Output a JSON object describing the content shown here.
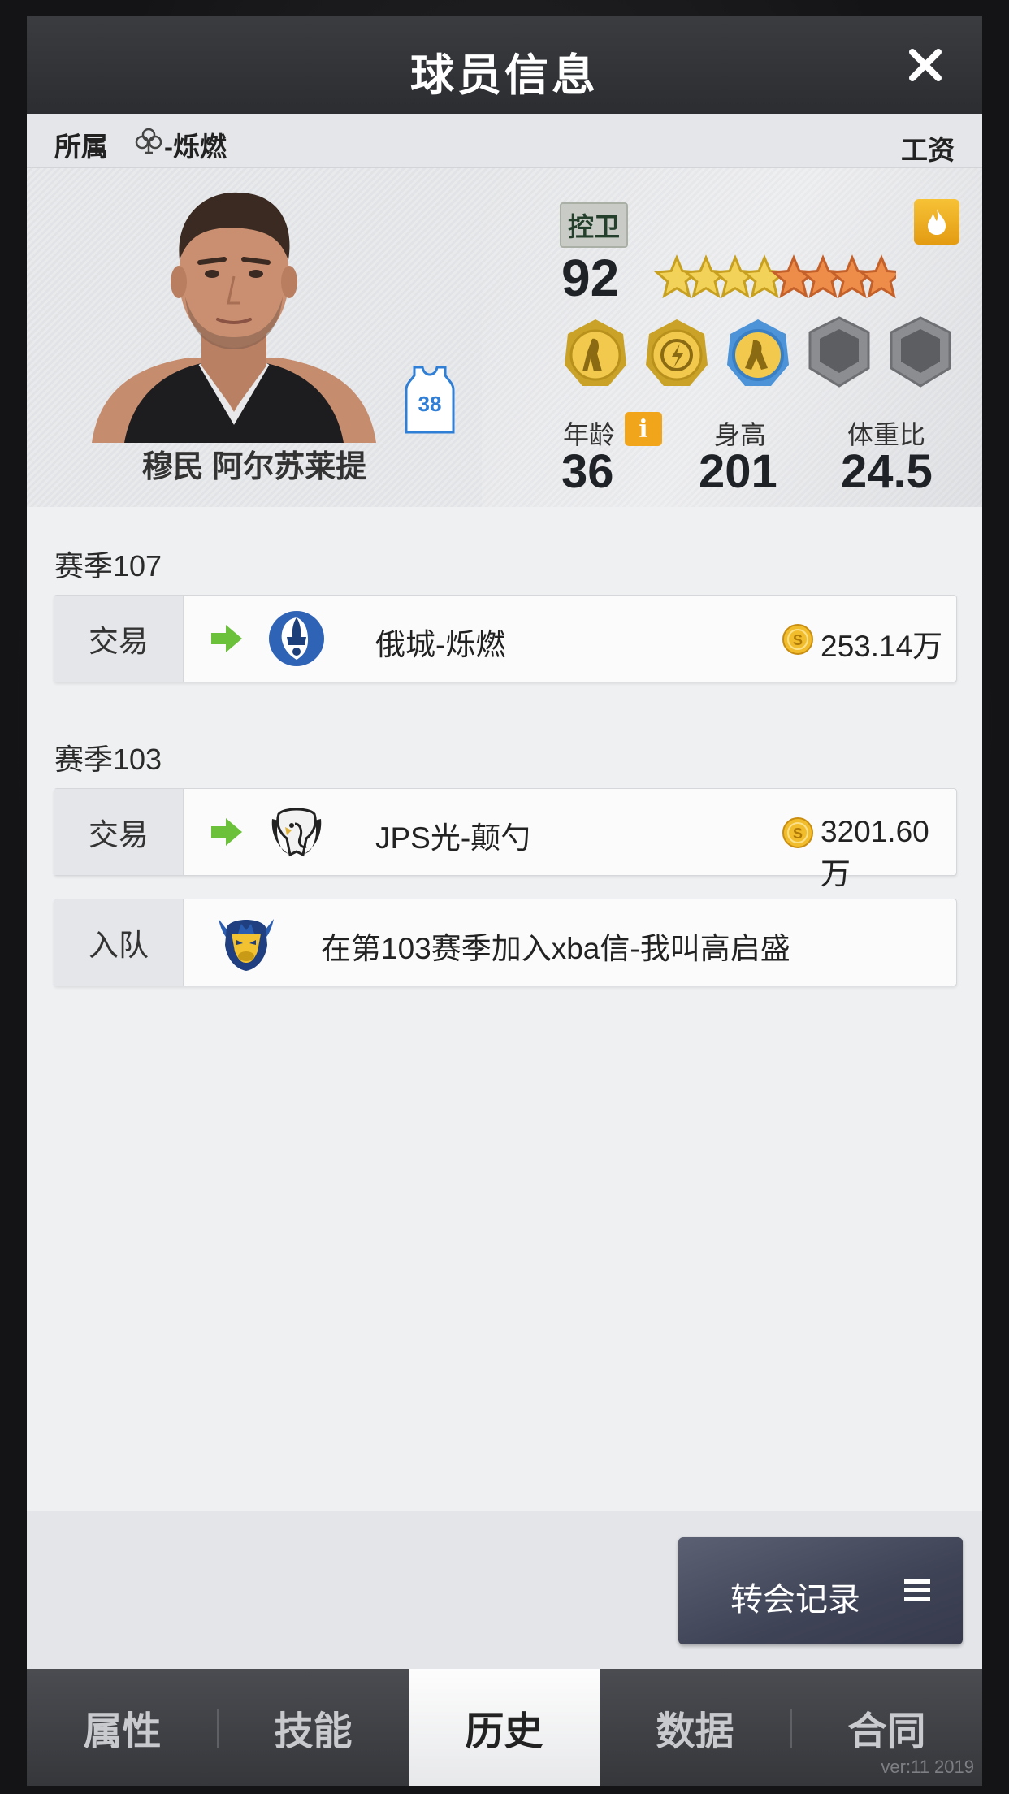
{
  "header": {
    "title": "球员信息"
  },
  "team_row": {
    "label": "所属",
    "team": "-烁燃",
    "salary_label": "工资"
  },
  "player": {
    "name": "穆民 阿尔苏莱提",
    "jersey_number": "38",
    "position": "控卫",
    "rating": "92",
    "stars": {
      "gold": 4,
      "bronze": 4
    },
    "age_label": "年龄",
    "age": "36",
    "height_label": "身高",
    "height": "201",
    "weight_ratio_label": "体重比",
    "weight_ratio": "24.5",
    "info_icon": "i"
  },
  "history": [
    {
      "season": "赛季107",
      "records": [
        {
          "type": "交易",
          "team": "俄城-烁燃",
          "fee": "253.14万"
        }
      ]
    },
    {
      "season": "赛季103",
      "records": [
        {
          "type": "交易",
          "team": "JPS光-颠勺",
          "fee": "3201.60万"
        },
        {
          "type": "入队",
          "text": "在第103赛季加入xba信-我叫高启盛"
        }
      ]
    }
  ],
  "transfer_button": {
    "label": "转会记录"
  },
  "tabs": [
    "属性",
    "技能",
    "历史",
    "数据",
    "合同"
  ],
  "active_tab": "历史",
  "version": "ver:11  2019",
  "colors": {
    "accent_gold": "#f1a51b",
    "arrow_green": "#6cc13a",
    "button_dark": "#3f4356"
  }
}
